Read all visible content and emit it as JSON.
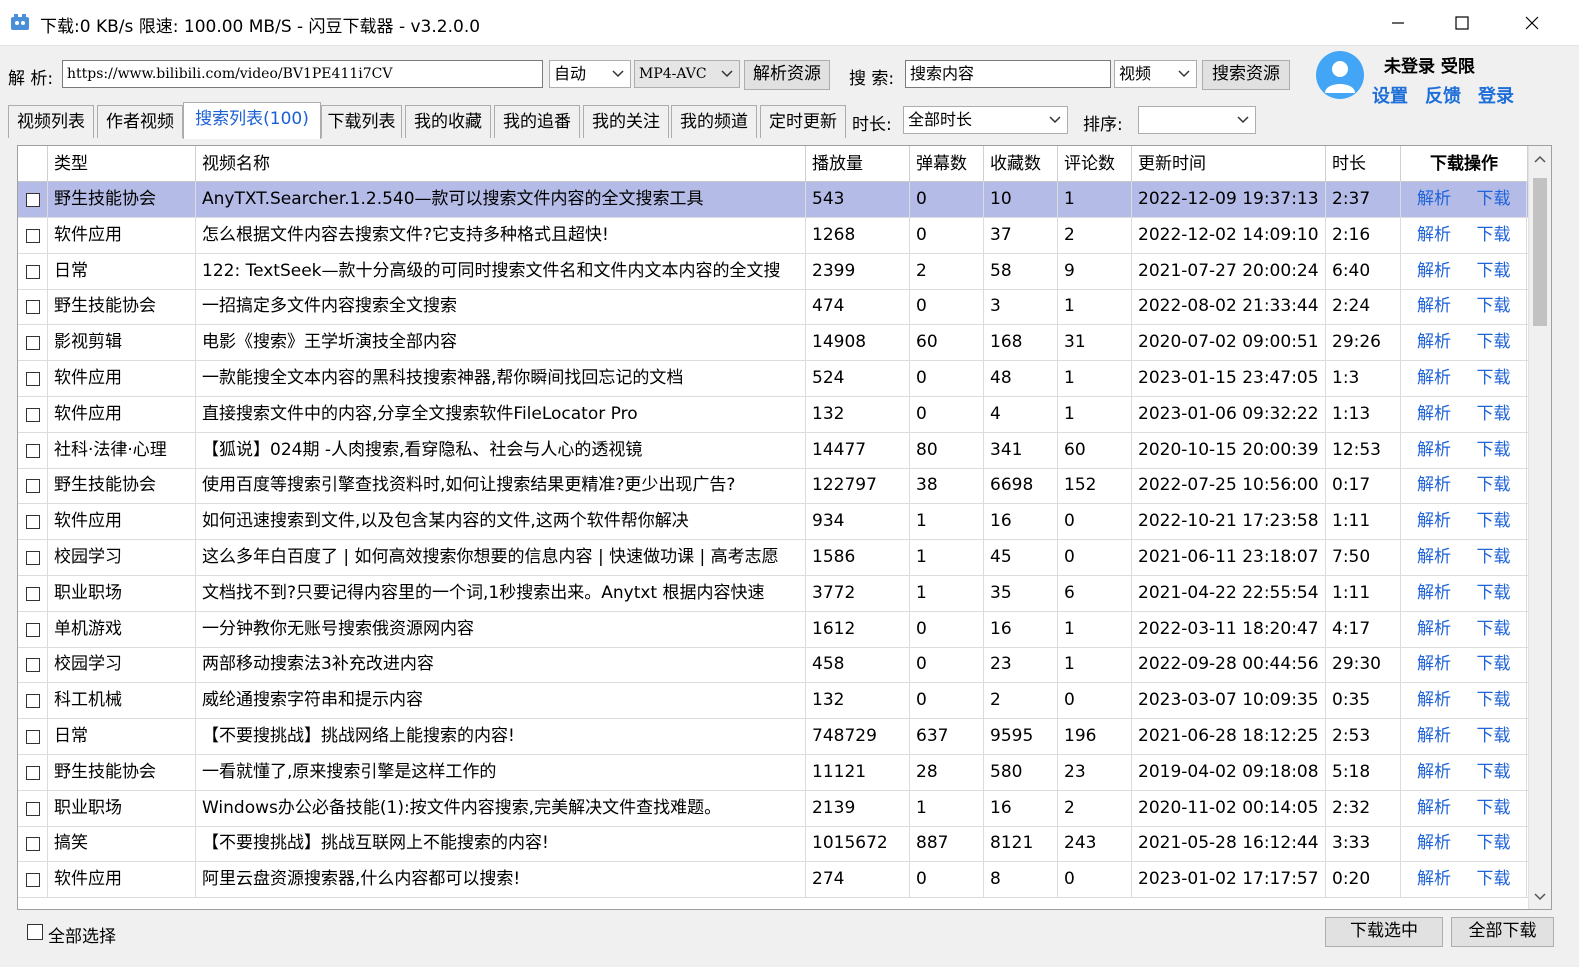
{
  "window": {
    "title": "下载:0 KB/s  限速:  100.00 MB/S  - 闪豆下载器 - v3.2.0.0"
  },
  "toolbar": {
    "parse_label": "解 析:",
    "url_value": "https://www.bilibili.com/video/BV1PE411i7CV",
    "mode_value": "自动",
    "format_value": "MP4-AVC",
    "parse_button": "解析资源",
    "search_label": "搜 索:",
    "search_value": "搜索内容",
    "search_type_value": "视频",
    "search_button": "搜索资源"
  },
  "user": {
    "status": "未登录  受限",
    "settings": "设置",
    "feedback": "反馈",
    "login": "登录"
  },
  "tabs": [
    {
      "label": "视频列表"
    },
    {
      "label": "作者视频"
    },
    {
      "label": "搜索列表(100)"
    },
    {
      "label": "下载列表"
    },
    {
      "label": "我的收藏"
    },
    {
      "label": "我的追番"
    },
    {
      "label": "我的关注"
    },
    {
      "label": "我的频道"
    },
    {
      "label": "定时更新"
    }
  ],
  "filters": {
    "duration_label": "时长:",
    "duration_value": "全部时长",
    "sort_label": "排序:",
    "sort_value": ""
  },
  "table": {
    "headers": [
      "类型",
      "视频名称",
      "播放量",
      "弹幕数",
      "收藏数",
      "评论数",
      "更新时间",
      "时长",
      "下载操作"
    ],
    "action_parse": "解析",
    "action_download": "下载",
    "rows": [
      [
        "野生技能协会",
        "AnyTXT.Searcher.1.2.540—款可以搜索文件内容的全文搜索工具",
        "543",
        "0",
        "10",
        "1",
        "2022-12-09 19:37:13",
        "2:37"
      ],
      [
        "软件应用",
        "怎么根据文件内容去搜索文件?它支持多种格式且超快!",
        "1268",
        "0",
        "37",
        "2",
        "2022-12-02 14:09:10",
        "2:16"
      ],
      [
        "日常",
        "122: TextSeek—款十分高级的可同时搜索文件名和文件内文本内容的全文搜",
        "2399",
        "2",
        "58",
        "9",
        "2021-07-27 20:00:24",
        "6:40"
      ],
      [
        "野生技能协会",
        "一招搞定多文件内容搜索全文搜索",
        "474",
        "0",
        "3",
        "1",
        "2022-08-02 21:33:44",
        "2:24"
      ],
      [
        "影视剪辑",
        "电影《搜索》王学圻演技全部内容",
        "14908",
        "60",
        "168",
        "31",
        "2020-07-02 09:00:51",
        "29:26"
      ],
      [
        "软件应用",
        "一款能搜全文本内容的黑科技搜索神器,帮你瞬间找回忘记的文档",
        "524",
        "0",
        "48",
        "1",
        "2023-01-15 23:47:05",
        "1:3"
      ],
      [
        "软件应用",
        "直接搜索文件中的内容,分享全文搜索软件FileLocator Pro",
        "132",
        "0",
        "4",
        "1",
        "2023-01-06 09:32:22",
        "1:13"
      ],
      [
        "社科·法律·心理",
        "【狐说】024期 -人肉搜索,看穿隐私、社会与人心的透视镜",
        "14477",
        "80",
        "341",
        "60",
        "2020-10-15 20:00:39",
        "12:53"
      ],
      [
        "野生技能协会",
        "使用百度等搜索引擎查找资料时,如何让搜索结果更精准?更少出现广告?",
        "122797",
        "38",
        "6698",
        "152",
        "2022-07-25 10:56:00",
        "0:17"
      ],
      [
        "软件应用",
        "如何迅速搜索到文件,以及包含某内容的文件,这两个软件帮你解决",
        "934",
        "1",
        "16",
        "0",
        "2022-10-21 17:23:58",
        "1:11"
      ],
      [
        "校园学习",
        "这么多年白百度了 | 如何高效搜索你想要的信息内容 | 快速做功课 | 高考志愿",
        "1586",
        "1",
        "45",
        "0",
        "2021-06-11 23:18:07",
        "7:50"
      ],
      [
        "职业职场",
        "文档找不到?只要记得内容里的一个词,1秒搜索出来。Anytxt 根据内容快速",
        "3772",
        "1",
        "35",
        "6",
        "2021-04-22 22:55:54",
        "1:11"
      ],
      [
        "单机游戏",
        "一分钟教你无账号搜索俄资源网内容",
        "1612",
        "0",
        "16",
        "1",
        "2022-03-11 18:20:47",
        "4:17"
      ],
      [
        "校园学习",
        "两部移动搜索法3补充改进内容",
        "458",
        "0",
        "23",
        "1",
        "2022-09-28 00:44:56",
        "29:30"
      ],
      [
        "科工机械",
        "威纶通搜索字符串和提示内容",
        "132",
        "0",
        "2",
        "0",
        "2023-03-07 10:09:35",
        "0:35"
      ],
      [
        "日常",
        "【不要搜挑战】挑战网络上能搜索的内容!",
        "748729",
        "637",
        "9595",
        "196",
        "2021-06-28 18:12:25",
        "2:53"
      ],
      [
        "野生技能协会",
        "一看就懂了,原来搜索引擎是这样工作的",
        "11121",
        "28",
        "580",
        "23",
        "2019-04-02 09:18:08",
        "5:18"
      ],
      [
        "职业职场",
        "Windows办公必备技能(1):按文件内容搜索,完美解决文件查找难题。",
        "2139",
        "1",
        "16",
        "2",
        "2020-11-02 00:14:05",
        "2:32"
      ],
      [
        "搞笑",
        "【不要搜挑战】挑战互联网上不能搜索的内容!",
        "1015672",
        "887",
        "8121",
        "243",
        "2021-05-28 16:12:44",
        "3:33"
      ],
      [
        "软件应用",
        "阿里云盘资源搜索器,什么内容都可以搜索!",
        "274",
        "0",
        "8",
        "0",
        "2023-01-02 17:17:57",
        "0:20"
      ]
    ]
  },
  "footer": {
    "select_all": "全部选择",
    "download_selected": "下载选中",
    "download_all": "全部下载"
  }
}
